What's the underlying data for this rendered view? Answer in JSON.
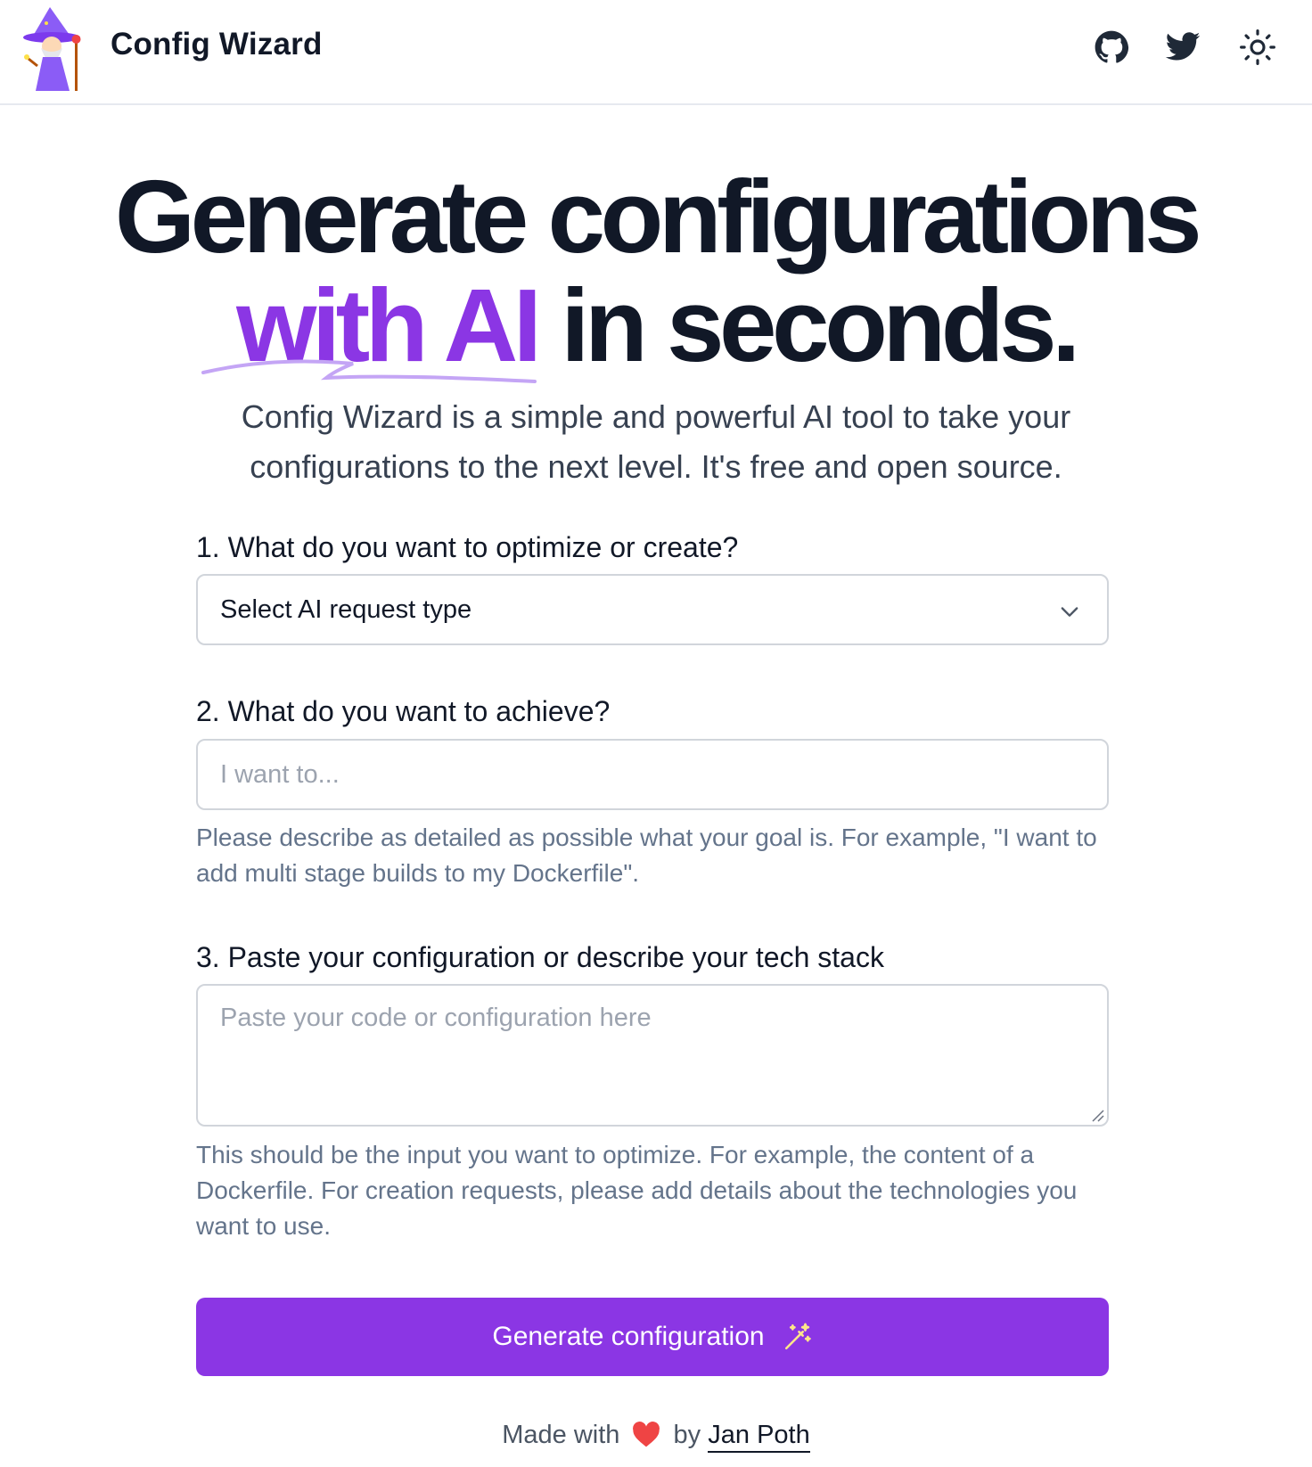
{
  "header": {
    "brand": "Config Wizard",
    "icons": [
      "wizard-logo",
      "github-icon",
      "twitter-icon",
      "sun-icon"
    ]
  },
  "hero": {
    "line1": "Generate configurations",
    "accent": "with AI",
    "rest": "in seconds.",
    "subtitle_line1": "Config Wizard is a simple and powerful AI tool to take your",
    "subtitle_line2": "configurations to the next level. It's free and open source."
  },
  "form": {
    "q1_label": "1. What do you want to optimize or create?",
    "select_value": "Select AI request type",
    "q2_label": "2. What do you want to achieve?",
    "goal_placeholder": "I want to...",
    "q2_help": "Please describe as detailed as possible what your goal is. For example, \"I want to add multi stage builds to my Dockerfile\".",
    "q3_label": "3. Paste your configuration or describe your tech stack",
    "config_placeholder": "Paste your code or configuration here",
    "q3_help": "This should be the input you want to optimize. For example, the content of a Dockerfile. For creation requests, please add details about the technologies you want to use.",
    "submit_label": "Generate configuration"
  },
  "footer": {
    "prefix": "Made with",
    "by": "by",
    "author": "Jan Poth"
  },
  "colors": {
    "accent": "#8b36e4",
    "heart": "#ef4444",
    "text": "#111827",
    "muted": "#64748b"
  }
}
